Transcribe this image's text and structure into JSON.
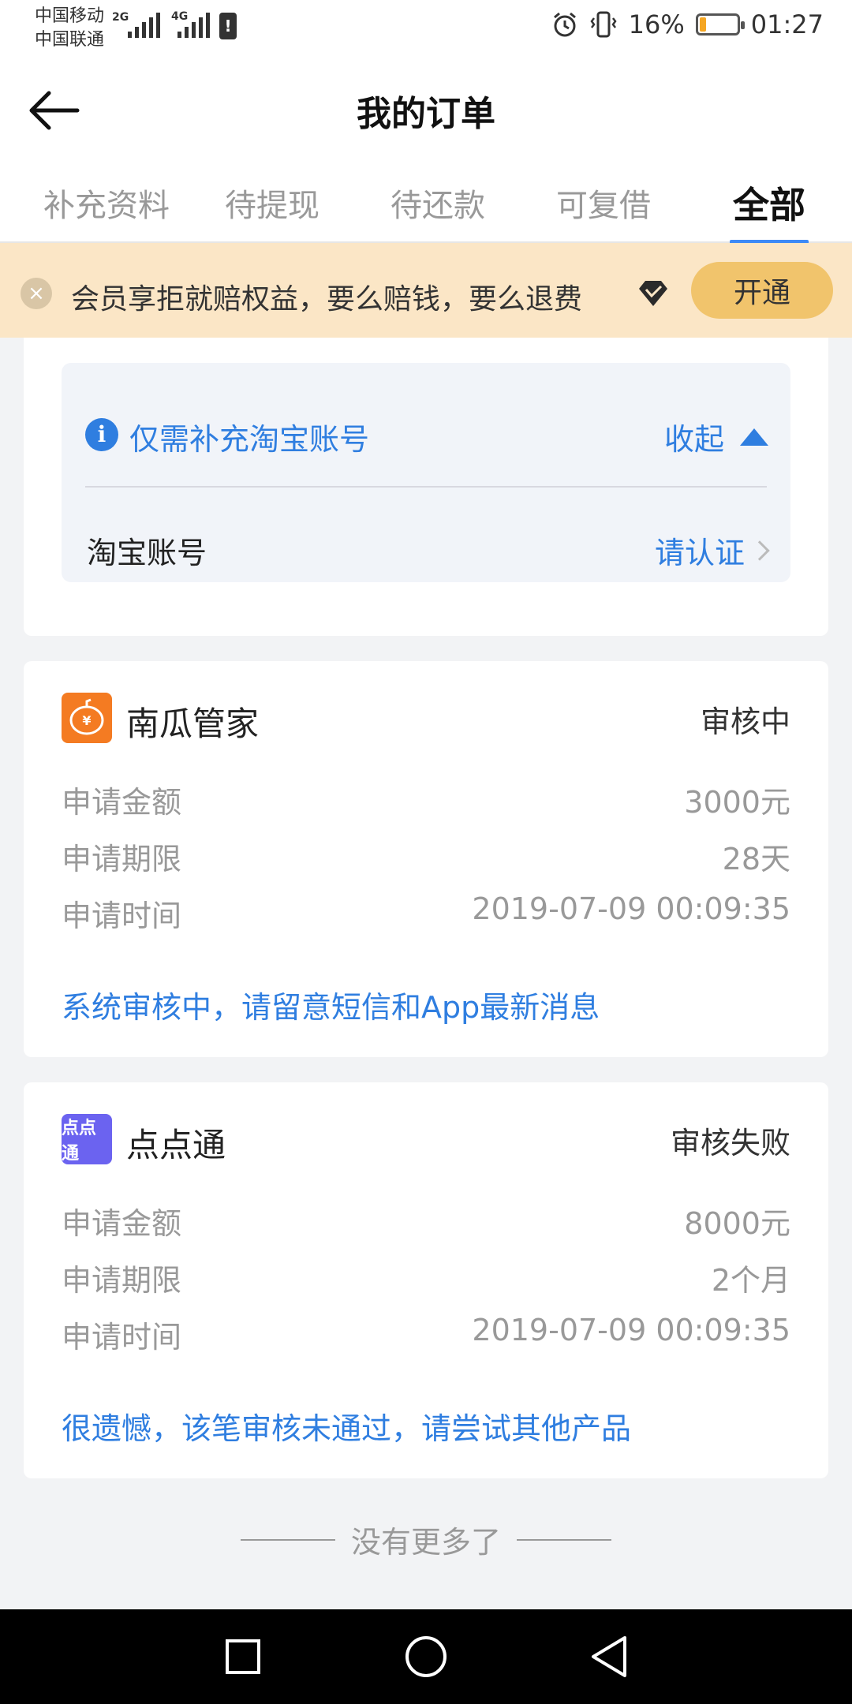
{
  "statusbar": {
    "carrier1": "中国移动",
    "carrier2": "中国联通",
    "net1": "2G",
    "net2": "4G",
    "battery_pct": "16%",
    "battery_level": 0.16,
    "time": "01:27"
  },
  "header": {
    "title": "我的订单"
  },
  "tabs": [
    {
      "label": "补充资料"
    },
    {
      "label": "待提现"
    },
    {
      "label": "待还款"
    },
    {
      "label": "可复借"
    },
    {
      "label": "全部"
    }
  ],
  "promo": {
    "text": "会员享拒就赔权益，要么赔钱，要么退费",
    "button": "开通"
  },
  "supplement": {
    "info_title": "仅需补充淘宝账号",
    "collapse": "收起",
    "field_label": "淘宝账号",
    "field_action": "请认证"
  },
  "orders": [
    {
      "name": "南瓜管家",
      "status": "审核中",
      "rows": [
        {
          "label": "申请金额",
          "value": "3000元"
        },
        {
          "label": "申请期限",
          "value": "28天"
        },
        {
          "label": "申请时间",
          "value": "2019-07-09 00:09:35"
        }
      ],
      "message": "系统审核中，请留意短信和App最新消息"
    },
    {
      "name": "点点通",
      "logo_text": "点点通",
      "status": "审核失败",
      "rows": [
        {
          "label": "申请金额",
          "value": "8000元"
        },
        {
          "label": "申请期限",
          "value": "2个月"
        },
        {
          "label": "申请时间",
          "value": "2019-07-09 00:09:35"
        }
      ],
      "message": "很遗憾，该笔审核未通过，请尝试其他产品"
    }
  ],
  "footer": {
    "end_text": "没有更多了"
  },
  "colors": {
    "accent": "#2f7ee0",
    "tab_indicator": "#3d8af7",
    "promo_bg": "#fbe6c6",
    "promo_button": "#f1c46c",
    "battery_low": "#f5a623"
  }
}
